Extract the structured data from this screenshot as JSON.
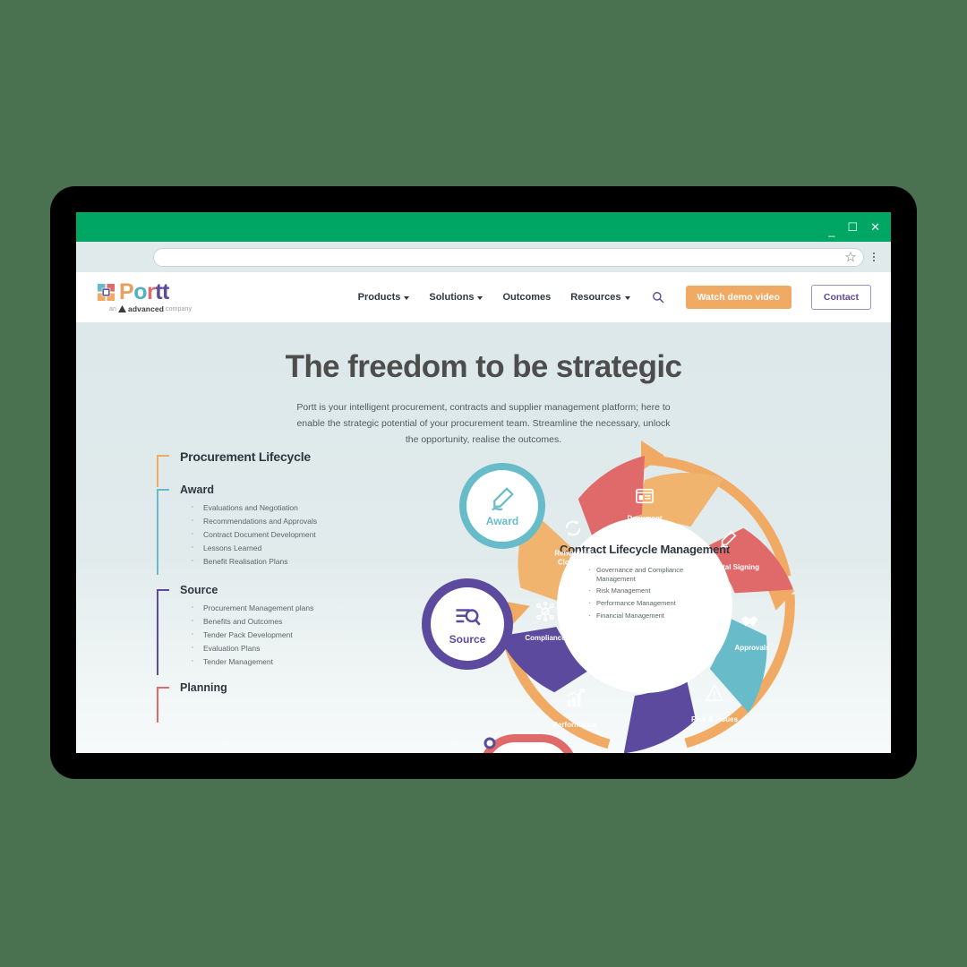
{
  "browser": {
    "titlebar_color": "#00a664",
    "minimize": "_",
    "maximize": "☐",
    "close": "✕",
    "url_value": "",
    "url_placeholder": ""
  },
  "site": {
    "logo": {
      "word_parts": [
        "P",
        "o",
        "r",
        "t",
        "t"
      ],
      "sub_prefix": "an",
      "sub_brand": "advanced",
      "sub_suffix": "company"
    },
    "nav": [
      {
        "label": "Products",
        "has_caret": true
      },
      {
        "label": "Solutions",
        "has_caret": true
      },
      {
        "label": "Outcomes",
        "has_caret": false
      },
      {
        "label": "Resources",
        "has_caret": true
      }
    ],
    "search_icon": "search-icon",
    "buttons": {
      "demo": "Watch demo video",
      "demo_color": "#f0aa64",
      "contact": "Contact",
      "contact_color": "#5b4a9e"
    }
  },
  "hero": {
    "heading": "The freedom to be strategic",
    "paragraph": "Portt is your intelligent procurement, contracts and supplier management platform; here to enable the strategic potential of your procurement team. Streamline the necessary, unlock the opportunity, realise the outcomes."
  },
  "lifecycle": {
    "title": "Procurement Lifecycle",
    "title_rail_color": "#f0aa64",
    "sections": [
      {
        "heading": "Award",
        "rail_color": "#68bcc9",
        "items": [
          "Evaluations and Negotiation",
          "Recommendations and Approvals",
          "Contract Document Development",
          "Lessons Learned",
          "Benefit Realisation Plans"
        ]
      },
      {
        "heading": "Source",
        "rail_color": "#5b4a9e",
        "items": [
          "Procurement Management plans",
          "Benefits and Outcomes",
          "Tender Pack Development",
          "Evaluation Plans",
          "Tender Management"
        ]
      },
      {
        "heading": "Planning",
        "rail_color": "#e06a6a",
        "items": []
      }
    ]
  },
  "wheel": {
    "hub_title": "Contract Lifecycle Management",
    "hub_items": [
      "Governance and Compliance Management",
      "Risk Management",
      "Performance Management",
      "Financial Management"
    ],
    "outer_ring_color": "#f0aa64",
    "segments": [
      {
        "label": "Document Authoring",
        "color": "#f0b46e",
        "icon": "document-icon"
      },
      {
        "label": "Digital Signing",
        "color": "#e06a6a",
        "icon": "pen-signature-icon"
      },
      {
        "label": "Approvals",
        "color": "#68bcc9",
        "icon": "handshake-icon"
      },
      {
        "label": "Risk & Issues",
        "color": "#5b4a9e",
        "icon": "warning-triangle-icon"
      },
      {
        "label": "Performance",
        "color": "#5b4a9e",
        "icon": "bar-chart-icon"
      },
      {
        "label": "Compliance",
        "color": "#f0b46e",
        "icon": "network-check-icon"
      },
      {
        "label": "Renewals / Closeout",
        "color": "#e06a6a",
        "icon": "refresh-cycle-icon"
      }
    ],
    "nodes": [
      {
        "label": "Award",
        "color": "#68bcc9",
        "icon": "pen-icon"
      },
      {
        "label": "Source",
        "color": "#5b4a9e",
        "icon": "search-list-icon"
      }
    ]
  }
}
